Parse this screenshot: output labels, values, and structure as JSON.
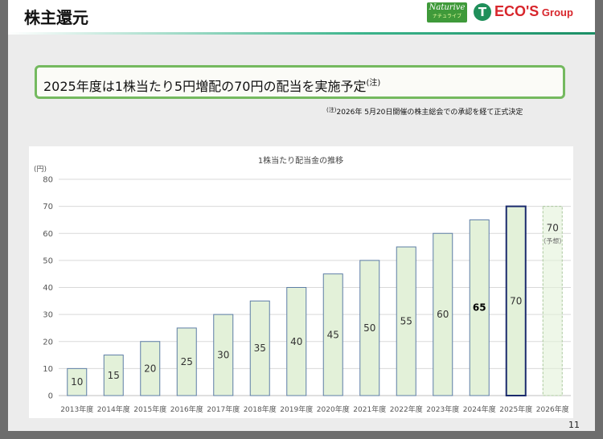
{
  "page": {
    "title": "株主還元",
    "headline": "2025年度は1株当たり5円増配の70円の配当を実施予定",
    "headline_note_mark": "(注)",
    "note_mark": "(注)",
    "note": "2026年 5月20日開催の株主総会での承認を経て正式決定",
    "page_number": "11",
    "logos": {
      "naturive_main": "Naturive",
      "naturive_sub": "ナチュライブ",
      "ecos_mark": "T",
      "ecos_name": "ECO'S",
      "ecos_group": " Group"
    }
  },
  "colors": {
    "bar_fill": "#e3f1d9",
    "bar_stroke": "#5d7da6",
    "highlight_stroke": "#1a2a6c",
    "forecast_stroke": "#a9c79b",
    "grid": "#d9d9d9",
    "accent_green": "#74b95f",
    "logo_red": "#d8262c"
  },
  "chart_data": {
    "type": "bar",
    "title": "1株当たり配当金の推移",
    "ylabel": "(円)",
    "ylim": [
      0,
      80
    ],
    "yticks": [
      0,
      10,
      20,
      30,
      40,
      50,
      60,
      70,
      80
    ],
    "grid": true,
    "categories": [
      "2013年度",
      "2014年度",
      "2015年度",
      "2016年度",
      "2017年度",
      "2018年度",
      "2019年度",
      "2020年度",
      "2021年度",
      "2022年度",
      "2023年度",
      "2024年度",
      "2025年度",
      "2026年度"
    ],
    "values": [
      10,
      15,
      20,
      25,
      30,
      35,
      40,
      45,
      50,
      55,
      60,
      65,
      70,
      70
    ],
    "value_labels": [
      "10",
      "15",
      "20",
      "25",
      "30",
      "35",
      "40",
      "45",
      "50",
      "55",
      "60",
      "65",
      "70",
      "70"
    ],
    "highlight_index": 12,
    "forecast_index": 13,
    "forecast_label": "（予想）"
  }
}
